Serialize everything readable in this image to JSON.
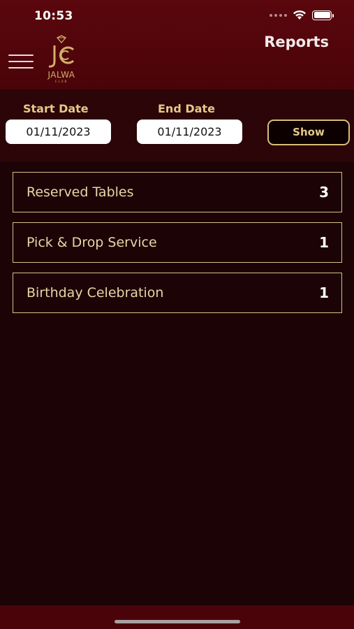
{
  "status_bar": {
    "time": "10:53"
  },
  "header": {
    "title": "Reports",
    "logo_initials": "JC",
    "logo_text": "JALWA",
    "logo_subtext": "CLUB"
  },
  "filters": {
    "start_label": "Start Date",
    "start_value": "01/11/2023",
    "end_label": "End Date",
    "end_value": "01/11/2023",
    "show_label": "Show"
  },
  "reports": [
    {
      "label": "Reserved Tables",
      "count": "3"
    },
    {
      "label": "Pick & Drop Service",
      "count": "1"
    },
    {
      "label": "Birthday Celebration",
      "count": "1"
    }
  ],
  "colors": {
    "header_bg": "#5a070d",
    "body_bg": "#1c0306",
    "accent_gold": "#d6c089"
  },
  "icons": [
    "menu-icon",
    "wifi-icon",
    "battery-icon",
    "jalwa-club-logo"
  ]
}
